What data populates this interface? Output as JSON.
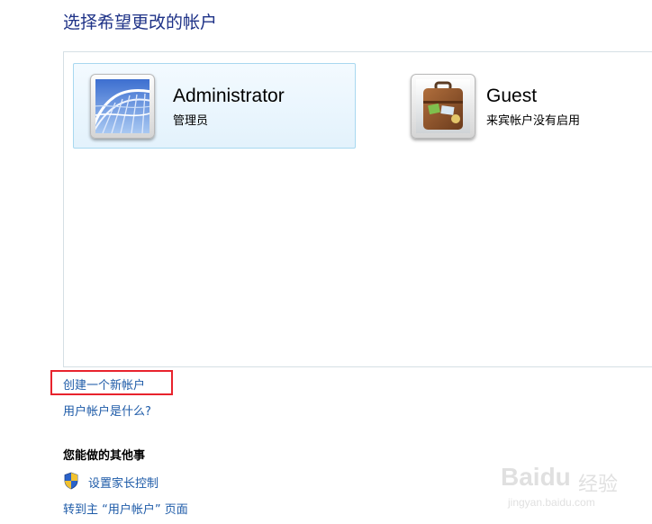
{
  "page": {
    "title": "选择希望更改的帐户"
  },
  "accounts": [
    {
      "name": "Administrator",
      "role": "管理员",
      "icon": "roller-coaster-icon"
    },
    {
      "name": "Guest",
      "role": "来宾帐户没有启用",
      "icon": "suitcase-icon"
    }
  ],
  "links": {
    "create_account": "创建一个新帐户",
    "what_is_account": "用户帐户是什么?"
  },
  "other_tasks": {
    "heading": "您能做的其他事",
    "parental_controls": "设置家长控制",
    "go_to_main": "转到主 “用户帐户” 页面"
  },
  "watermark": {
    "brand": "Baidu",
    "brand_cn": "经验",
    "url": "jingyan.baidu.com"
  },
  "colors": {
    "title": "#1e3287",
    "link": "#1e5ba8",
    "highlight": "#e8232d",
    "selected_border": "#a8d8f0"
  }
}
